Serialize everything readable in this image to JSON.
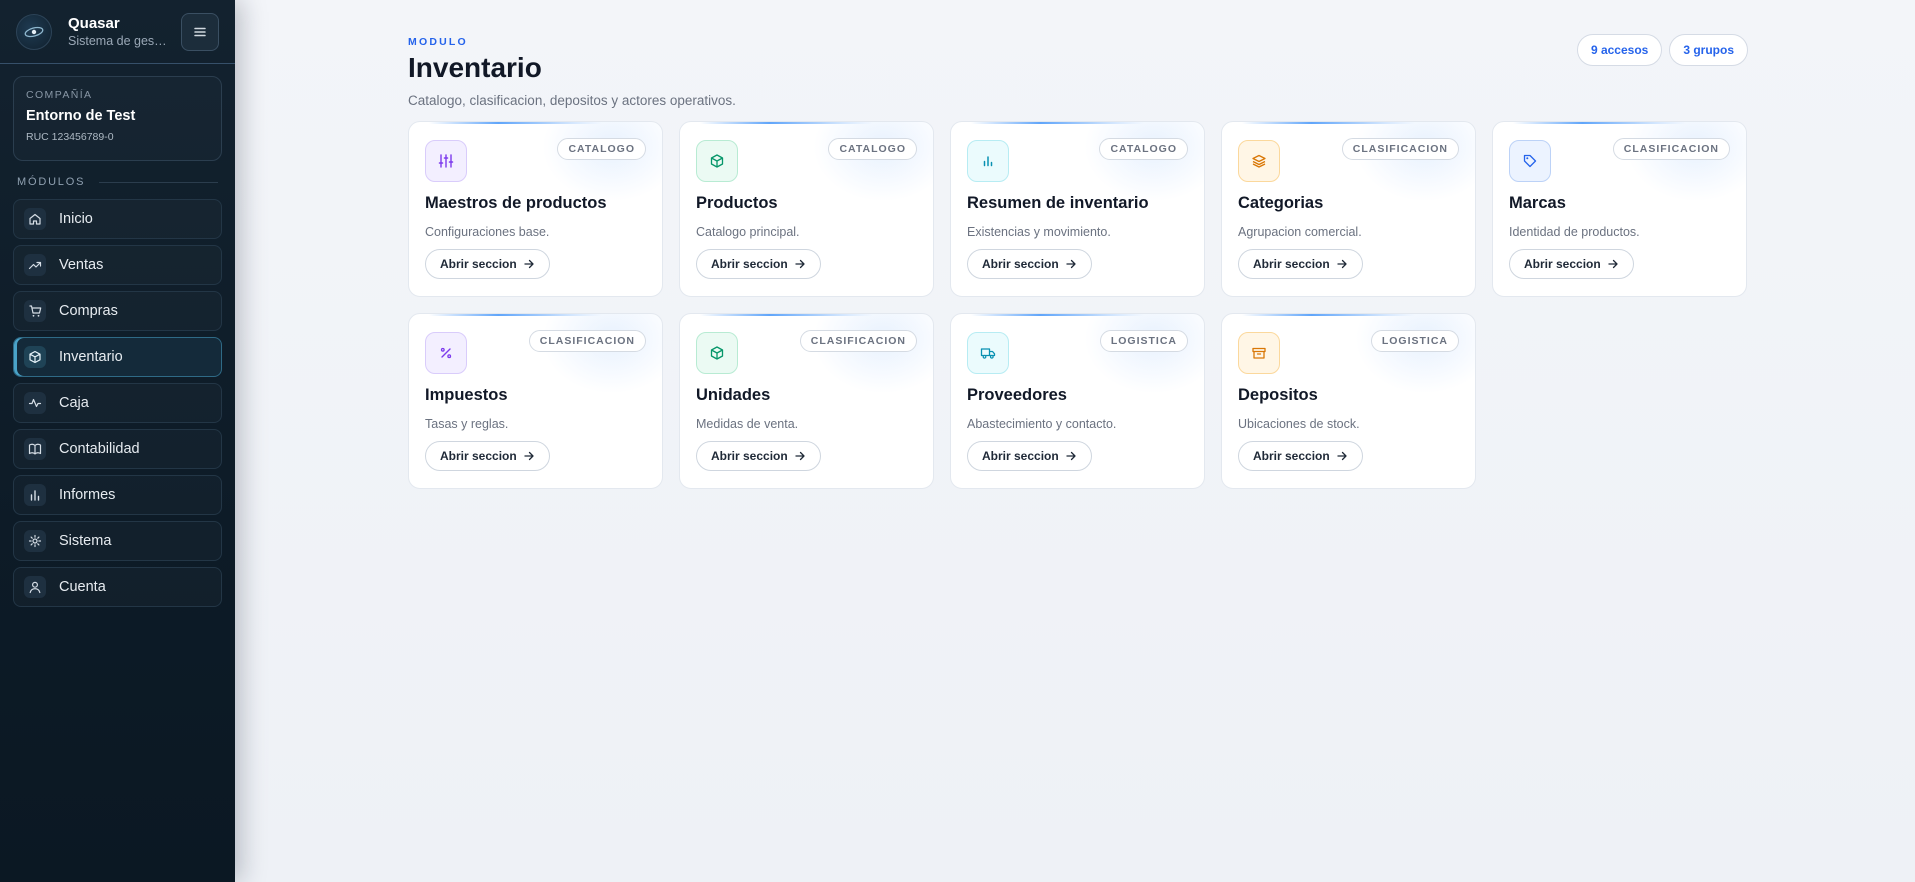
{
  "brand": {
    "name": "Quasar",
    "subtitle": "Sistema de gest..."
  },
  "company": {
    "label": "COMPAÑÍA",
    "name": "Entorno de Test",
    "ruc": "RUC 123456789-0"
  },
  "sidebar": {
    "section_label": "MÓDULOS",
    "items": [
      {
        "label": "Inicio",
        "icon": "home-icon"
      },
      {
        "label": "Ventas",
        "icon": "trending-up-icon"
      },
      {
        "label": "Compras",
        "icon": "cart-icon"
      },
      {
        "label": "Inventario",
        "icon": "box-icon",
        "active": true
      },
      {
        "label": "Caja",
        "icon": "activity-icon"
      },
      {
        "label": "Contabilidad",
        "icon": "book-icon"
      },
      {
        "label": "Informes",
        "icon": "bar-chart-icon"
      },
      {
        "label": "Sistema",
        "icon": "gear-icon"
      },
      {
        "label": "Cuenta",
        "icon": "user-icon"
      }
    ]
  },
  "header": {
    "overline": "MODULO",
    "title": "Inventario",
    "subtitle": "Catalogo, clasificacion, depositos y actores operativos.",
    "accesos": "9 accesos",
    "grupos": "3 grupos"
  },
  "cards": [
    {
      "title": "Maestros de productos",
      "badge": "CATALOGO",
      "desc": "Configuraciones base.",
      "button": "Abrir seccion",
      "icon": "sliders-icon",
      "color": "#7c3aed"
    },
    {
      "title": "Productos",
      "badge": "CATALOGO",
      "desc": "Catalogo principal.",
      "button": "Abrir seccion",
      "icon": "box-icon",
      "color": "#059669"
    },
    {
      "title": "Resumen de inventario",
      "badge": "CATALOGO",
      "desc": "Existencias y movimiento.",
      "button": "Abrir seccion",
      "icon": "bar-chart-icon",
      "color": "#0891b2"
    },
    {
      "title": "Categorias",
      "badge": "CLASIFICACION",
      "desc": "Agrupacion comercial.",
      "button": "Abrir seccion",
      "icon": "layers-icon",
      "color": "#d97706"
    },
    {
      "title": "Marcas",
      "badge": "CLASIFICACION",
      "desc": "Identidad de productos.",
      "button": "Abrir seccion",
      "icon": "tag-icon",
      "color": "#2563eb"
    },
    {
      "title": "Impuestos",
      "badge": "CLASIFICACION",
      "desc": "Tasas y reglas.",
      "button": "Abrir seccion",
      "icon": "percent-icon",
      "color": "#7c3aed"
    },
    {
      "title": "Unidades",
      "badge": "CLASIFICACION",
      "desc": "Medidas de venta.",
      "button": "Abrir seccion",
      "icon": "box-icon",
      "color": "#059669"
    },
    {
      "title": "Proveedores",
      "badge": "LOGISTICA",
      "desc": "Abastecimiento y contacto.",
      "button": "Abrir seccion",
      "icon": "truck-icon",
      "color": "#0891b2"
    },
    {
      "title": "Depositos",
      "badge": "LOGISTICA",
      "desc": "Ubicaciones de stock.",
      "button": "Abrir seccion",
      "icon": "archive-icon",
      "color": "#d97706"
    }
  ]
}
